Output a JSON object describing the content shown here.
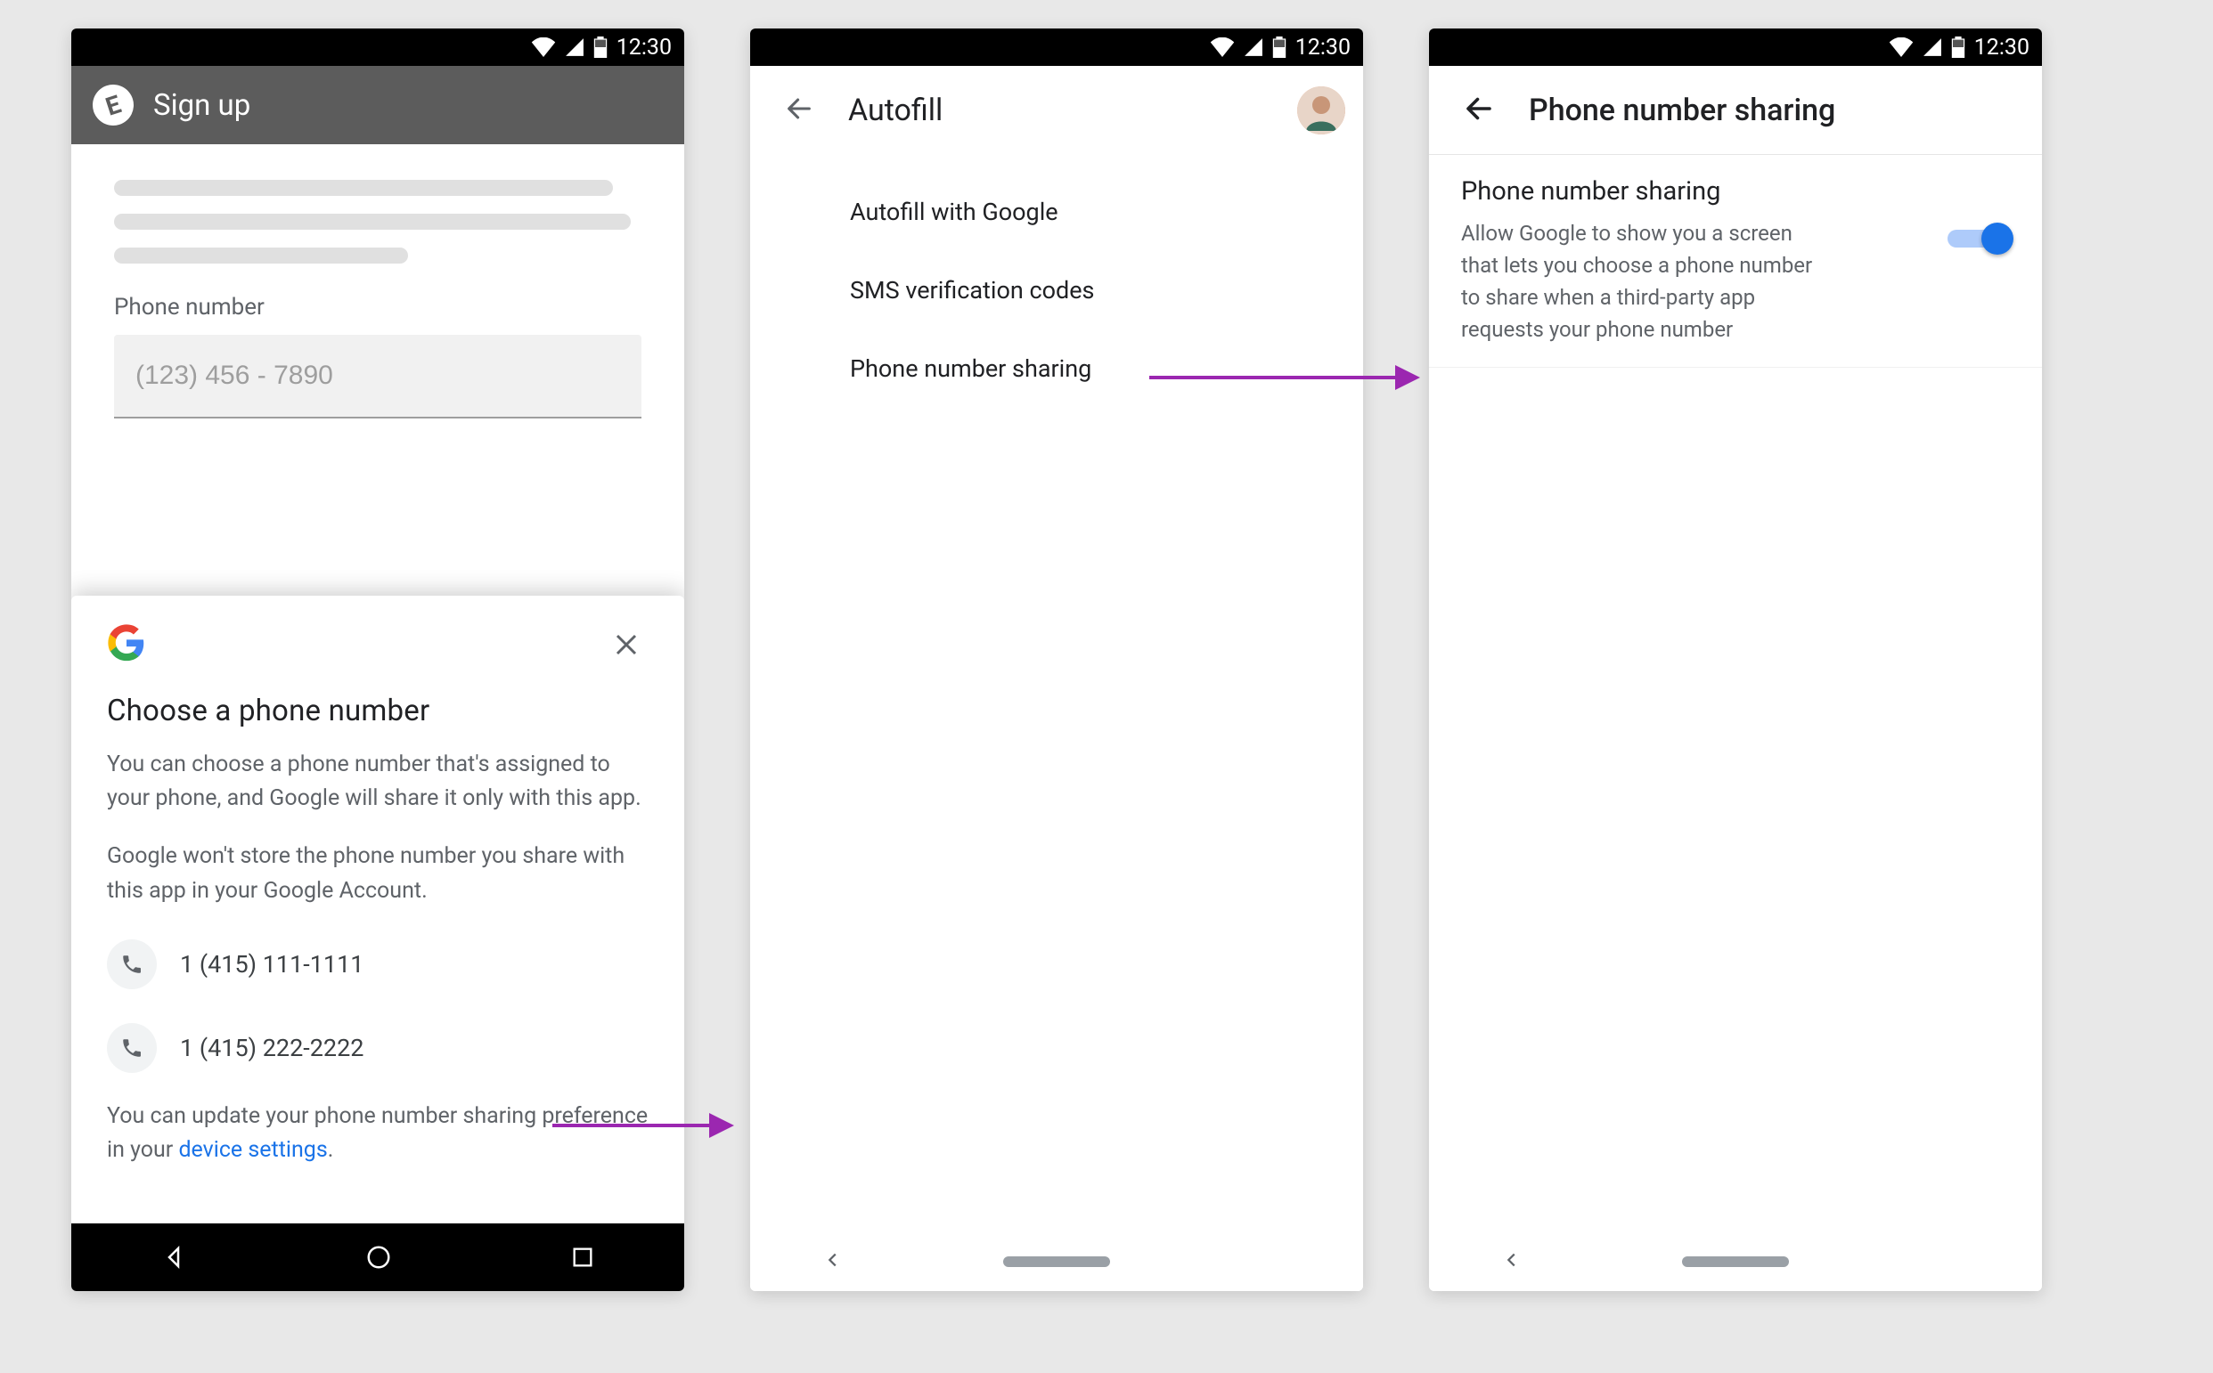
{
  "status_bar": {
    "time": "12:30"
  },
  "screen1": {
    "app_title": "Sign up",
    "app_logo_letter": "E",
    "field_label": "Phone number",
    "field_placeholder": "(123) 456 - 7890",
    "sheet": {
      "heading": "Choose a phone number",
      "para1": "You can choose a phone number that's assigned to your phone, and Google will share it only with this app.",
      "para2": "Google won't store the phone number you share with this app in your Google Account.",
      "numbers": [
        "1 (415) 111-1111",
        "1 (415) 222-2222"
      ],
      "footer_pre": "You can update your phone number sharing preference in your ",
      "footer_link": "device settings",
      "footer_post": "."
    }
  },
  "screen2": {
    "title": "Autofill",
    "items": [
      "Autofill with Google",
      "SMS verification codes",
      "Phone number sharing"
    ]
  },
  "screen3": {
    "title": "Phone number sharing",
    "setting_title": "Phone number sharing",
    "setting_desc": "Allow Google to show you a screen that lets you choose a phone number to share when a third-party app requests your phone number"
  }
}
